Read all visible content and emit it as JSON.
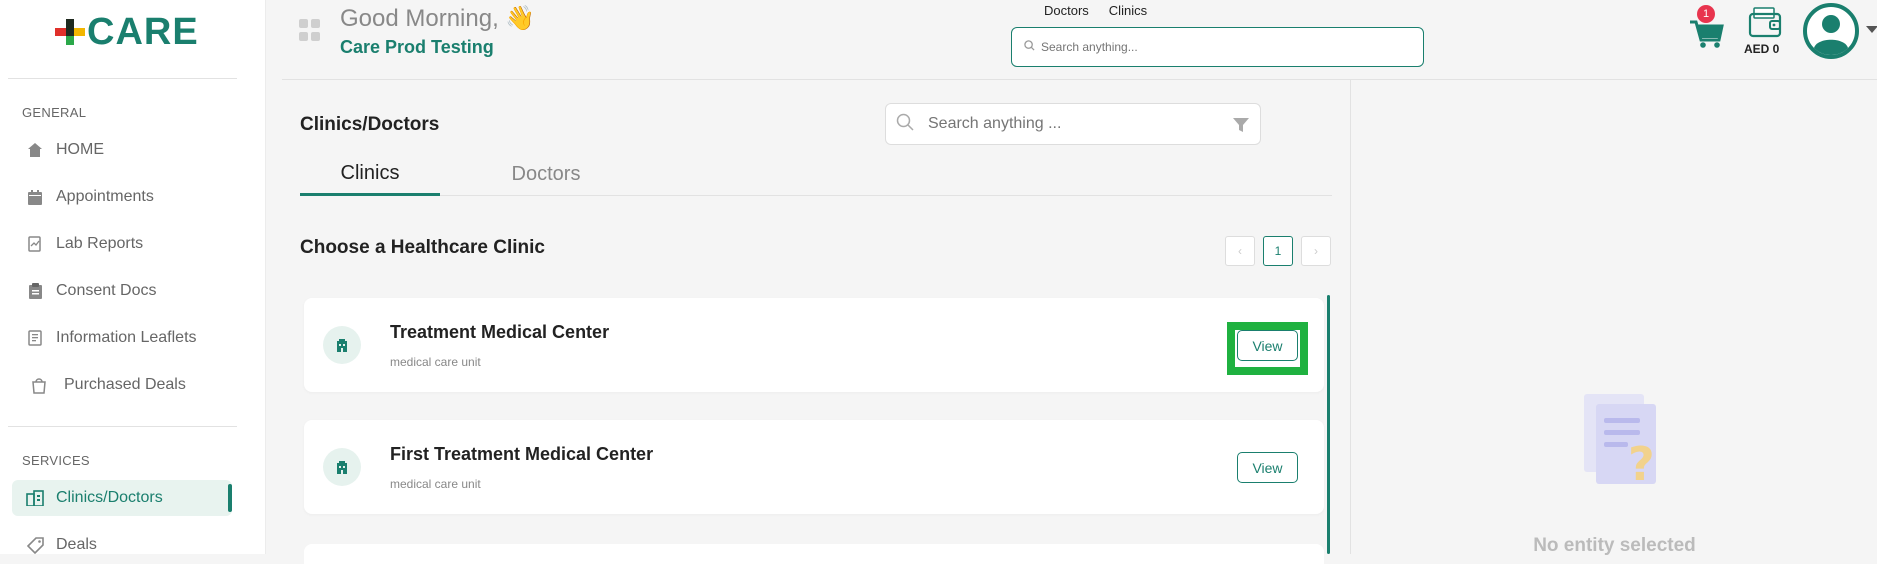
{
  "brand": {
    "logo_text": "CARE",
    "accent": "#1a7f6e"
  },
  "sidebar": {
    "general_label": "GENERAL",
    "services_label": "SERVICES",
    "items": [
      {
        "label": "HOME",
        "icon": "home-icon"
      },
      {
        "label": "Appointments",
        "icon": "calendar-icon"
      },
      {
        "label": "Lab Reports",
        "icon": "lab-report-icon"
      },
      {
        "label": "Consent Docs",
        "icon": "clipboard-icon"
      },
      {
        "label": "Information Leaflets",
        "icon": "leaflet-icon"
      },
      {
        "label": "Purchased Deals",
        "icon": "deal-bag-icon"
      }
    ],
    "service_items": [
      {
        "label": "Clinics/Doctors",
        "icon": "hospital-icon",
        "active": true
      },
      {
        "label": "Deals",
        "icon": "tag-icon"
      }
    ]
  },
  "header": {
    "greeting": "Good Morning, 👋",
    "org_name": "Care Prod Testing",
    "search_tabs": [
      "Doctors",
      "Clinics"
    ],
    "search_placeholder": "Search anything...",
    "cart_count": "1",
    "wallet_balance": "AED 0"
  },
  "main": {
    "title": "Clinics/Doctors",
    "search_placeholder": "Search anything ...",
    "tabs": [
      {
        "label": "Clinics",
        "active": true
      },
      {
        "label": "Doctors",
        "active": false
      }
    ],
    "section_heading": "Choose a Healthcare Clinic",
    "pager": {
      "prev": "‹",
      "current": "1",
      "next": "›"
    },
    "clinics": [
      {
        "name": "Treatment Medical Center",
        "type": "medical care unit",
        "button": "View"
      },
      {
        "name": "First Treatment Medical Center",
        "type": "medical care unit",
        "button": "View"
      }
    ]
  },
  "right_panel": {
    "empty_text": "No entity selected"
  }
}
